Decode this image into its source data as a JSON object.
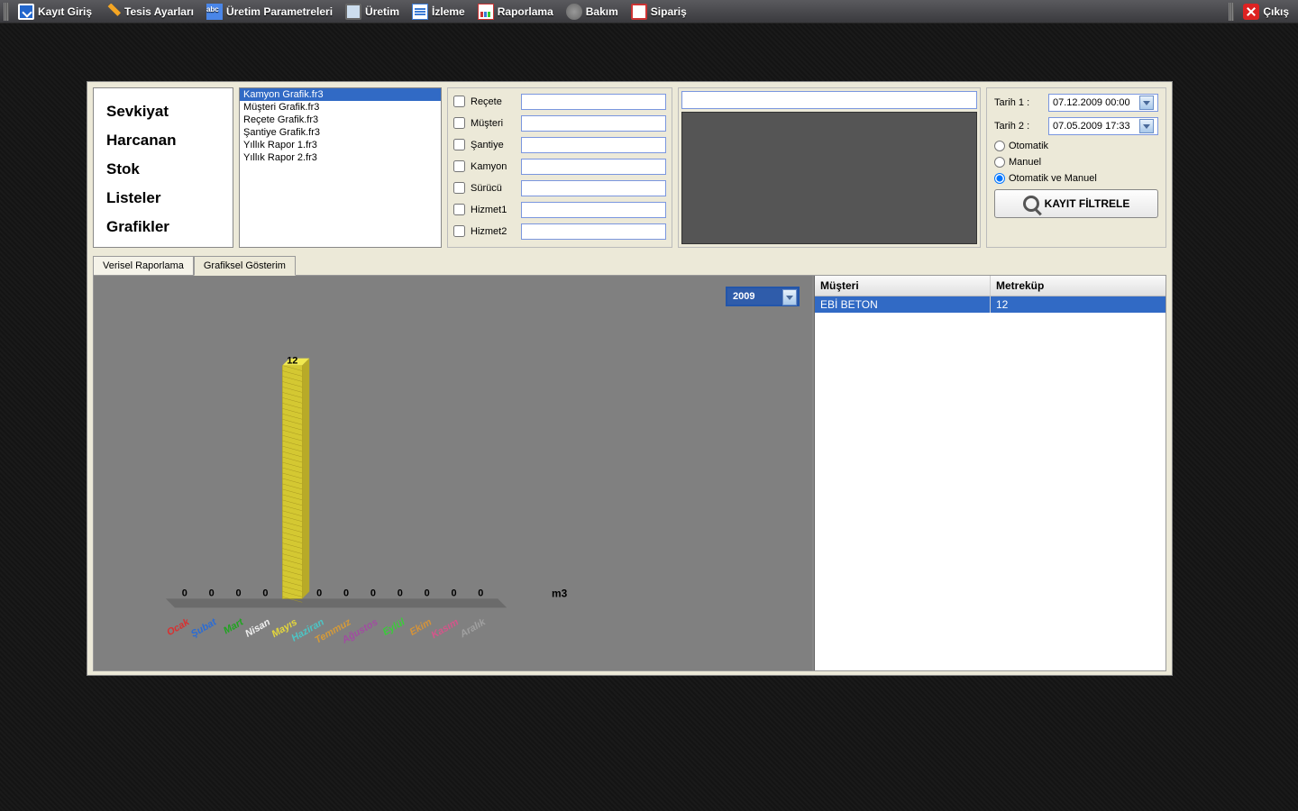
{
  "toolbar": {
    "items": [
      "Kayıt Giriş",
      "Tesis Ayarları",
      "Üretim Parametreleri",
      "Üretim",
      "İzleme",
      "Raporlama",
      "Bakım",
      "Sipariş"
    ],
    "exit": "Çıkış"
  },
  "sidebar": {
    "items": [
      "Sevkiyat",
      "Harcanan",
      "Stok",
      "Listeler",
      "Grafikler"
    ]
  },
  "file_list": {
    "items": [
      "Kamyon Grafik.fr3",
      "Müşteri Grafik.fr3",
      "Reçete Grafik.fr3",
      "Şantiye Grafik.fr3",
      "Yıllık Rapor 1.fr3",
      "Yıllık Rapor 2.fr3"
    ],
    "selected_index": 0
  },
  "filters": {
    "labels": [
      "Reçete",
      "Müşteri",
      "Şantiye",
      "Kamyon",
      "Sürücü",
      "Hizmet1",
      "Hizmet2"
    ]
  },
  "date_panel": {
    "tarih1_label": "Tarih 1 :",
    "tarih2_label": "Tarih 2 :",
    "tarih1": "07.12.2009 00:00",
    "tarih2": "07.05.2009 17:33",
    "radio_otomatik": "Otomatik",
    "radio_manuel": "Manuel",
    "radio_both": "Otomatik ve Manuel",
    "selected_radio": "radio_both",
    "button": "KAYIT FİLTRELE"
  },
  "tabs": {
    "tab1": "Verisel Raporlama",
    "tab2": "Grafiksel Gösterim"
  },
  "year_select": "2009",
  "data_table": {
    "col1": "Müşteri",
    "col2": "Metreküp",
    "rows": [
      {
        "musteri": "EBİ BETON",
        "m3": "12"
      }
    ]
  },
  "chart_data": {
    "type": "bar",
    "categories": [
      "Ocak",
      "Şubat",
      "Mart",
      "Nisan",
      "Mayıs",
      "Haziran",
      "Temmuz",
      "Ağustos",
      "Eylül",
      "Ekim",
      "Kasım",
      "Aralık"
    ],
    "values": [
      0,
      0,
      0,
      0,
      12,
      0,
      0,
      0,
      0,
      0,
      0,
      0
    ],
    "unit_label": "m3",
    "month_colors": [
      "#d93030",
      "#2b6cd4",
      "#1fa41f",
      "#f0f0f0",
      "#e6d83a",
      "#4cc5c5",
      "#d49a3a",
      "#a04da0",
      "#3acc3a",
      "#d4933a",
      "#d4558a",
      "#a0a0a0"
    ],
    "ylim": [
      0,
      12
    ]
  }
}
